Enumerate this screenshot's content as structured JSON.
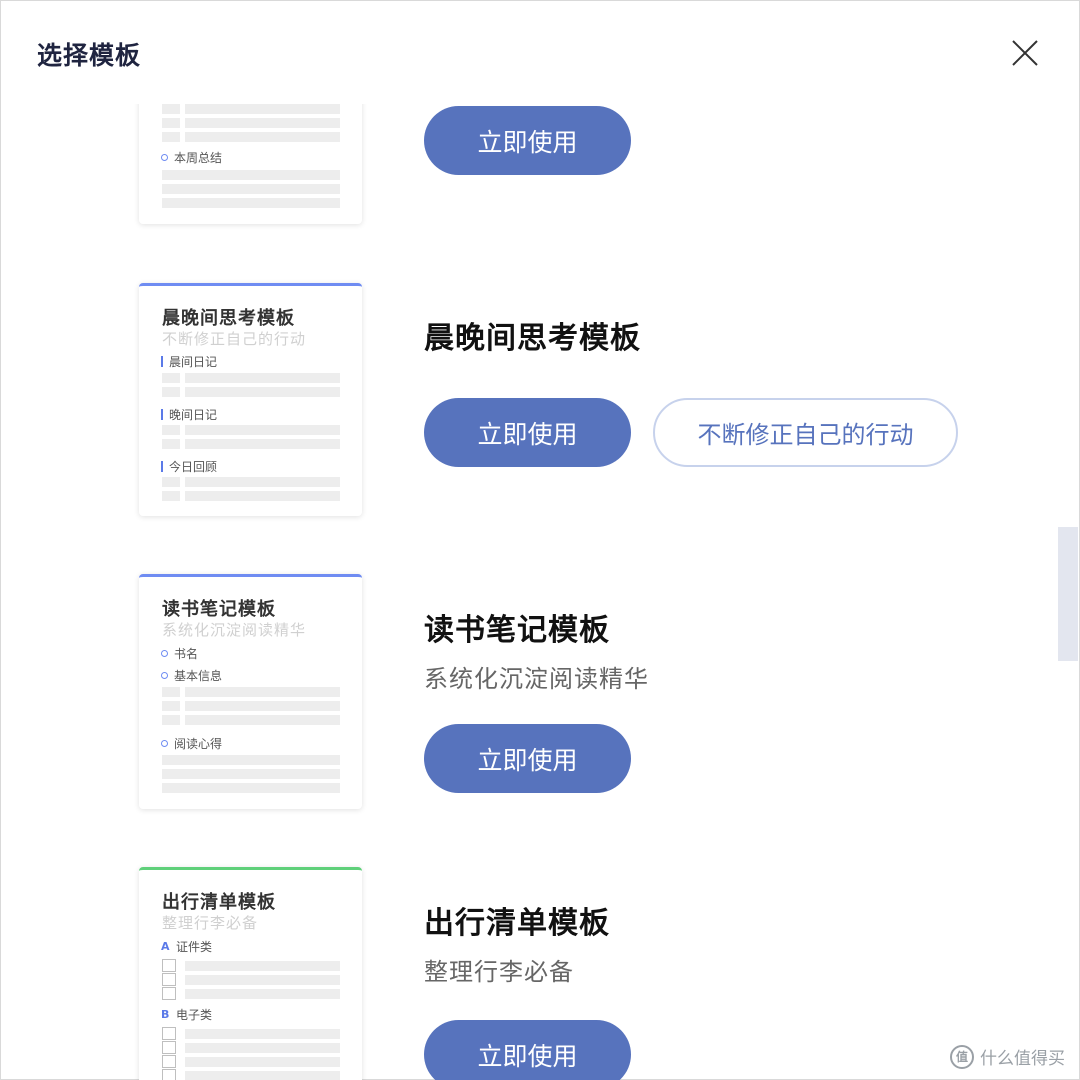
{
  "dialog": {
    "title": "选择模板"
  },
  "templates": [
    {
      "name": "",
      "desc": "",
      "preview": {
        "sections": [
          "本周总结"
        ]
      },
      "use_label": "立即使用"
    },
    {
      "name": "晨晚间思考模板",
      "desc": "",
      "tag": "不断修正自己的行动",
      "preview": {
        "title": "晨晚间思考模板",
        "sub": "不断修正自己的行动",
        "sections": [
          "晨间日记",
          "晚间日记",
          "今日回顾"
        ]
      },
      "use_label": "立即使用"
    },
    {
      "name": "读书笔记模板",
      "desc": "系统化沉淀阅读精华",
      "preview": {
        "title": "读书笔记模板",
        "sub": "系统化沉淀阅读精华",
        "sections": [
          "书名",
          "基本信息",
          "阅读心得"
        ]
      },
      "use_label": "立即使用"
    },
    {
      "name": "出行清单模板",
      "desc": "整理行李必备",
      "preview": {
        "title": "出行清单模板",
        "sub": "整理行李必备",
        "sections": [
          "证件类",
          "电子类"
        ],
        "letters": [
          "A",
          "B"
        ]
      },
      "use_label": "立即使用"
    }
  ],
  "colors": {
    "primary": "#5773bd",
    "accent_blue": "#6f8cf2",
    "accent_green": "#5fd07a"
  },
  "icons": {
    "close": "close-icon",
    "watermark": "smzdm-logo-icon"
  },
  "watermark": {
    "logo": "值",
    "text": "什么值得买"
  }
}
